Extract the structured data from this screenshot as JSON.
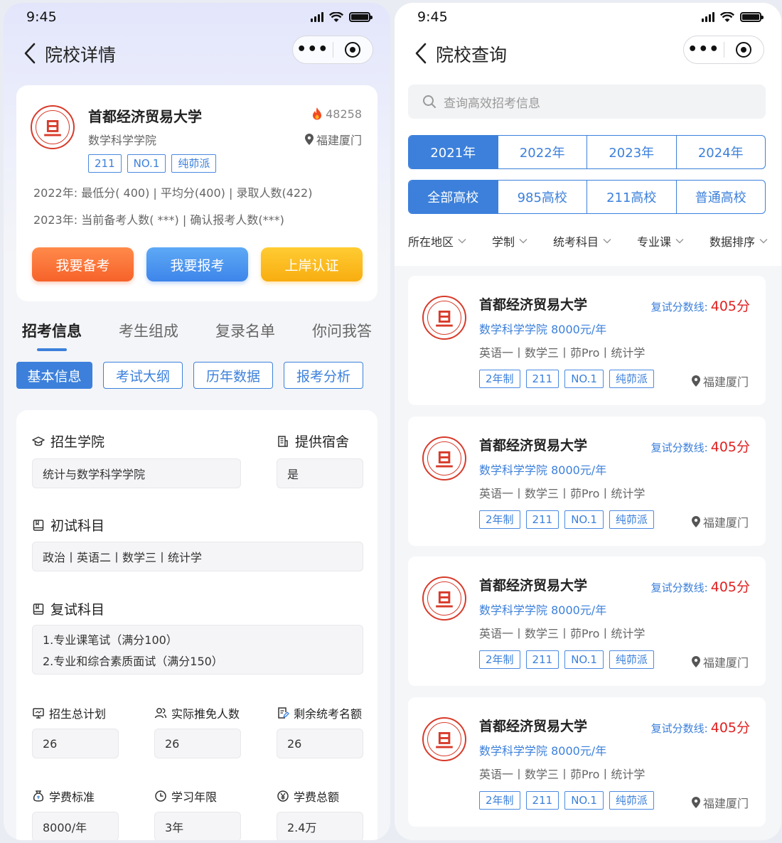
{
  "status_bar": {
    "time": "9:45"
  },
  "left": {
    "nav_title": "院校详情",
    "capsule_more": "•••",
    "school": {
      "name": "首都经济贸易大学",
      "logo_glyph": "旦",
      "hot_count": "48258",
      "college": "数学科学学院",
      "location": "福建厦门",
      "tags": [
        "211",
        "NO.1",
        "纯茆派"
      ],
      "line_2022": "2022年:  最低分( 400)  |  平均分(400)   |  录取人数(422)",
      "line_2023": "2023年:  当前备考人数( ***)  |   确认报考人数(***)"
    },
    "buttons": {
      "prepare": "我要备考",
      "apply": "我要报考",
      "certify": "上岸认证"
    },
    "main_tabs": [
      "招考信息",
      "考生组成",
      "复录名单",
      "你问我答"
    ],
    "sub_tabs": [
      "基本信息",
      "考试大纲",
      "历年数据",
      "报考分析"
    ],
    "info": {
      "college_label": "招生学院",
      "college_value": "统计与数学科学学院",
      "dorm_label": "提供宿舍",
      "dorm_value": "是",
      "first_exam_label": "初试科目",
      "first_exam_value": "政治丨英语二丨数学三丨统计学",
      "second_exam_label": "复试科目",
      "second_exam_lines": [
        "1.专业课笔试（满分100）",
        "2.专业和综合素质面试（满分150）"
      ],
      "plan_label": "招生总计划",
      "plan_value": "26",
      "exempt_label": "实际推免人数",
      "exempt_value": "26",
      "remain_label": "剩余统考名额",
      "remain_value": "26",
      "fee_label": "学费标准",
      "fee_value": "8000/年",
      "years_label": "学习年限",
      "years_value": "3年",
      "total_fee_label": "学费总额",
      "total_fee_value": "2.4万"
    }
  },
  "right": {
    "nav_title": "院校查询",
    "capsule_more": "•••",
    "search_placeholder": "查询高效招考信息",
    "years": [
      "2021年",
      "2022年",
      "2023年",
      "2024年"
    ],
    "types": [
      "全部高校",
      "985高校",
      "211高校",
      "普通高校"
    ],
    "filters": [
      "所在地区",
      "学制",
      "统考科目",
      "专业课",
      "数据排序"
    ],
    "list": [
      {
        "name": "首都经济贸易大学",
        "score_label": "复试分数线:",
        "score": "405分",
        "college": "数学科学学院    8000元/年",
        "subjects": "英语一丨数学三丨茆Pro丨统计学",
        "tags": [
          "2年制",
          "211",
          "NO.1",
          "纯茆派"
        ],
        "location": "福建厦门"
      },
      {
        "name": "首都经济贸易大学",
        "score_label": "复试分数线:",
        "score": "405分",
        "college": "数学科学学院    8000元/年",
        "subjects": "英语一丨数学三丨茆Pro丨统计学",
        "tags": [
          "2年制",
          "211",
          "NO.1",
          "纯茆派"
        ],
        "location": "福建厦门"
      },
      {
        "name": "首都经济贸易大学",
        "score_label": "复试分数线:",
        "score": "405分",
        "college": "数学科学学院    8000元/年",
        "subjects": "英语一丨数学三丨茆Pro丨统计学",
        "tags": [
          "2年制",
          "211",
          "NO.1",
          "纯茆派"
        ],
        "location": "福建厦门"
      },
      {
        "name": "首都经济贸易大学",
        "score_label": "复试分数线:",
        "score": "405分",
        "college": "数学科学学院    8000元/年",
        "subjects": "英语一丨数学三丨茆Pro丨统计学",
        "tags": [
          "2年制",
          "211",
          "NO.1",
          "纯茆派"
        ],
        "location": "福建厦门"
      }
    ]
  },
  "colors": {
    "primary": "#3c80db",
    "orange": "#f6622a",
    "yellow": "#f8ad10",
    "red": "#e02020",
    "logo_red": "#d83a2a"
  }
}
